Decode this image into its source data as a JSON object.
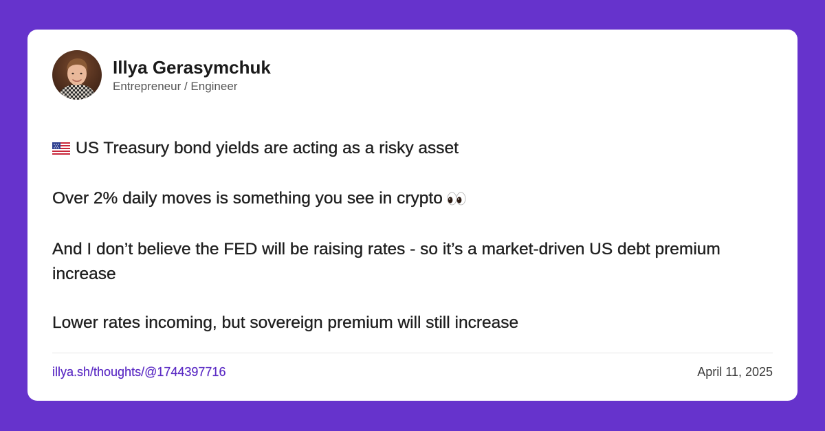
{
  "author": {
    "name": "Illya Gerasymchuk",
    "role": "Entrepreneur / Engineer"
  },
  "post": {
    "line1": "US Treasury bond yields are acting as a risky asset",
    "line2": "Over 2% daily moves is something you see in crypto",
    "line3": "And I don’t believe the FED will be raising rates - so it’s a market-driven US debt premium increase",
    "line4": "Lower rates incoming, but sovereign premium will still increase"
  },
  "icons": {
    "flag": "us-flag-icon",
    "eyes": "eyes-icon"
  },
  "footer": {
    "link": "illya.sh/thoughts/@1744397716",
    "date": "April 11, 2025"
  },
  "colors": {
    "background": "#6633cc",
    "card": "#ffffff",
    "link": "#5b2bc4"
  }
}
